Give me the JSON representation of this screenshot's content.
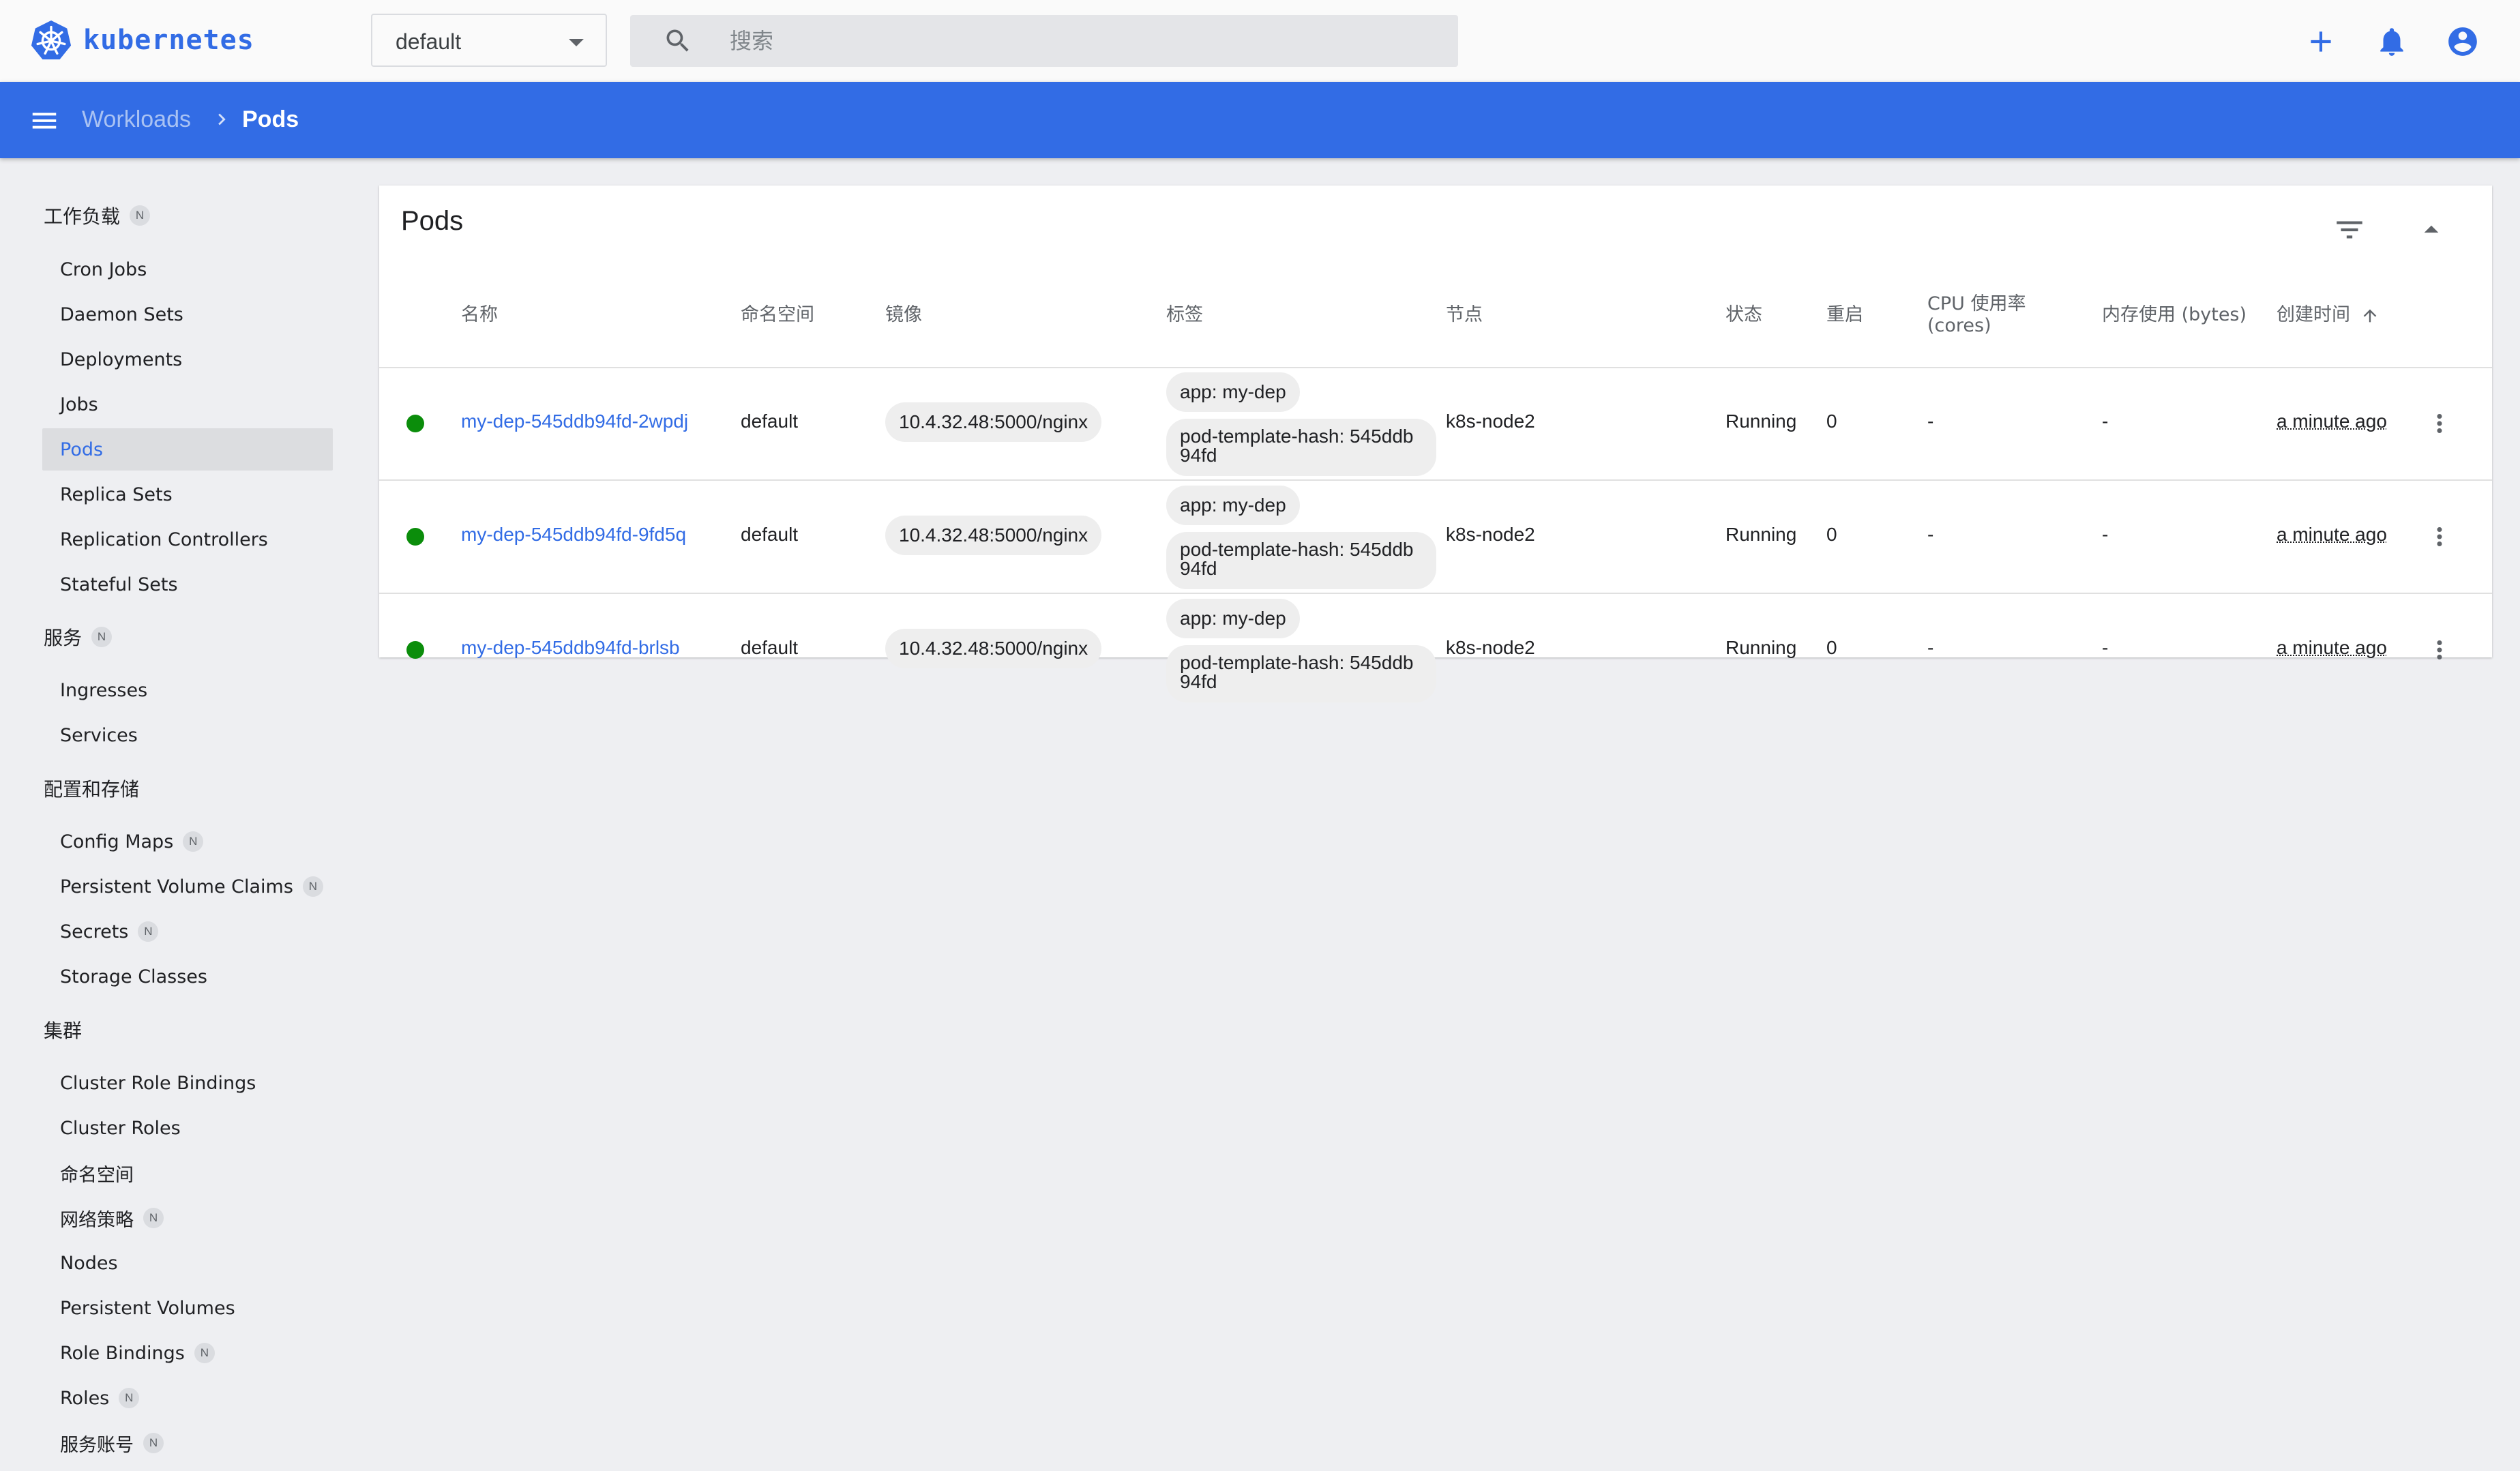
{
  "app": {
    "logo_text": "kubernetes"
  },
  "topbar": {
    "namespace": "default",
    "search_placeholder": "搜索"
  },
  "navbar": {
    "breadcrumb_parent": "Workloads",
    "breadcrumb_current": "Pods"
  },
  "sidebar": {
    "sections": [
      {
        "title": "工作负载",
        "badge": "N"
      },
      {
        "title": "服务",
        "badge": "N"
      },
      {
        "title": "配置和存储"
      },
      {
        "title": "集群"
      }
    ],
    "workloads": [
      {
        "label": "Cron Jobs"
      },
      {
        "label": "Daemon Sets"
      },
      {
        "label": "Deployments"
      },
      {
        "label": "Jobs"
      },
      {
        "label": "Pods",
        "active": true
      },
      {
        "label": "Replica Sets"
      },
      {
        "label": "Replication Controllers"
      },
      {
        "label": "Stateful Sets"
      }
    ],
    "services": [
      {
        "label": "Ingresses"
      },
      {
        "label": "Services"
      }
    ],
    "config": [
      {
        "label": "Config Maps",
        "badge": "N"
      },
      {
        "label": "Persistent Volume Claims",
        "badge": "N"
      },
      {
        "label": "Secrets",
        "badge": "N"
      },
      {
        "label": "Storage Classes"
      }
    ],
    "cluster": [
      {
        "label": "Cluster Role Bindings"
      },
      {
        "label": "Cluster Roles"
      },
      {
        "label": "命名空间"
      },
      {
        "label": "网络策略",
        "badge": "N"
      },
      {
        "label": "Nodes"
      },
      {
        "label": "Persistent Volumes"
      },
      {
        "label": "Role Bindings",
        "badge": "N"
      },
      {
        "label": "Roles",
        "badge": "N"
      },
      {
        "label": "服务账号",
        "badge": "N"
      }
    ]
  },
  "card": {
    "title": "Pods",
    "columns": {
      "name": "名称",
      "namespace": "命名空间",
      "image": "镜像",
      "labels": "标签",
      "node": "节点",
      "status": "状态",
      "restarts": "重启",
      "cpu_line1": "CPU 使用率",
      "cpu_line2": "(cores)",
      "memory": "内存使用 (bytes)",
      "created": "创建时间"
    },
    "rows": [
      {
        "name": "my-dep-545ddb94fd-2wpdj",
        "namespace": "default",
        "image": "10.4.32.48:5000/nginx",
        "label1": "app: my-dep",
        "label2": "pod-template-hash: 545ddb94fd",
        "node": "k8s-node2",
        "status": "Running",
        "restarts": "0",
        "cpu": "-",
        "memory": "-",
        "created": "a minute ago"
      },
      {
        "name": "my-dep-545ddb94fd-9fd5q",
        "namespace": "default",
        "image": "10.4.32.48:5000/nginx",
        "label1": "app: my-dep",
        "label2": "pod-template-hash: 545ddb94fd",
        "node": "k8s-node2",
        "status": "Running",
        "restarts": "0",
        "cpu": "-",
        "memory": "-",
        "created": "a minute ago"
      },
      {
        "name": "my-dep-545ddb94fd-brlsb",
        "namespace": "default",
        "image": "10.4.32.48:5000/nginx",
        "label1": "app: my-dep",
        "label2": "pod-template-hash: 545ddb94fd",
        "node": "k8s-node2",
        "status": "Running",
        "restarts": "0",
        "cpu": "-",
        "memory": "-",
        "created": "a minute ago"
      }
    ]
  },
  "colors": {
    "brand": "#326ce5",
    "running": "#0b8d0b"
  },
  "icons": [
    "kubernetes-logo-icon",
    "search-icon",
    "add-icon",
    "notifications-icon",
    "account-icon",
    "menu-icon",
    "chevron-right-icon",
    "filter-icon",
    "collapse-icon",
    "sort-arrow-icon",
    "more-vert-icon",
    "status-dot-icon"
  ]
}
